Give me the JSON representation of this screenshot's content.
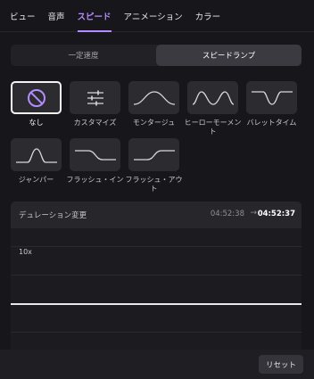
{
  "tabs": [
    "ビュー",
    "音声",
    "スピード",
    "アニメーション",
    "カラー"
  ],
  "active_tab": "スピード",
  "accent_color": "#b58cff",
  "segment": {
    "constant": "一定速度",
    "ramp": "スピードランプ",
    "active": "スピードランプ"
  },
  "presets": [
    {
      "label": "なし",
      "icon": "no-symbol-icon",
      "selected": true
    },
    {
      "label": "カスタマイズ",
      "icon": "sliders-icon",
      "selected": false
    },
    {
      "label": "モンタージュ",
      "icon": "wave-curve-icon",
      "selected": false
    },
    {
      "label": "ヒーローモーメント",
      "icon": "hero-curve-icon",
      "selected": false
    },
    {
      "label": "バレットタイム",
      "icon": "dip-curve-icon",
      "selected": false
    },
    {
      "label": "ジャンパー",
      "icon": "bump-curve-icon",
      "selected": false
    },
    {
      "label": "フラッシュ・イン",
      "icon": "step-down-curve-icon",
      "selected": false
    },
    {
      "label": "フラッシュ・アウト",
      "icon": "step-up-curve-icon",
      "selected": false
    }
  ],
  "duration": {
    "title": "デュレーション変更",
    "from": "04:52:38",
    "arrow": "→",
    "to": "04:52:37",
    "y_label": "10x"
  },
  "footer": {
    "reset_label": "リセット"
  }
}
